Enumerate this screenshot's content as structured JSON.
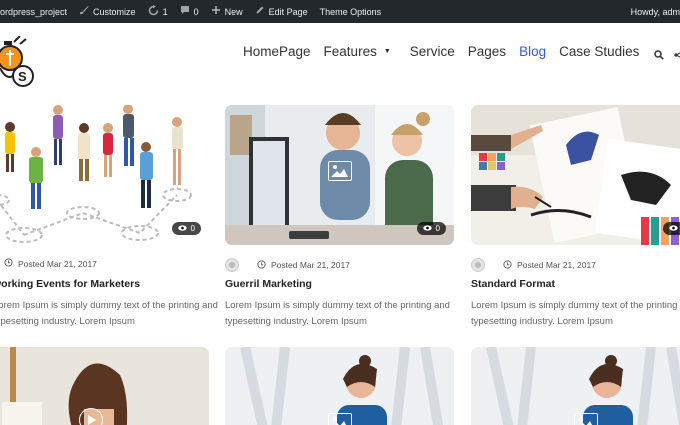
{
  "admin_bar": {
    "site": "ordpress_project",
    "customize": "Customize",
    "updates": "1",
    "comments": "0",
    "new": "New",
    "edit_page": "Edit Page",
    "theme_options": "Theme Options",
    "howdy": "Howdy, adm"
  },
  "nav": {
    "items": [
      {
        "label": "HomePage"
      },
      {
        "label": "Features"
      },
      {
        "label": "Service"
      },
      {
        "label": "Pages"
      },
      {
        "label": "Blog"
      },
      {
        "label": "Case Studies"
      }
    ],
    "active_color": "#3b5bdb"
  },
  "posts": [
    {
      "date": "Posted Mar 21, 2017",
      "title": "working Events for Marketers",
      "excerpt": "Lorem Ipsum is simply dummy text of the printing and typesetting industry. Lorem Ipsum",
      "views": "0"
    },
    {
      "date": "Posted Mar 21, 2017",
      "title": "Guerril Marketing",
      "excerpt": "Lorem Ipsum is simply dummy text of the printing and typesetting industry. Lorem Ipsum",
      "views": "0"
    },
    {
      "date": "Posted Mar 21, 2017",
      "title": "Standard Format",
      "excerpt": "Lorem Ipsum is simply dummy text of the printing and typesetting industry. Lorem Ipsum",
      "views": "0"
    }
  ],
  "icons": [
    "wordpress-icon",
    "brush-icon",
    "refresh-icon",
    "comment-icon",
    "plus-icon",
    "pencil-icon",
    "search-icon",
    "share-icon",
    "eye-icon",
    "clock-icon",
    "image-icon",
    "play-icon"
  ]
}
